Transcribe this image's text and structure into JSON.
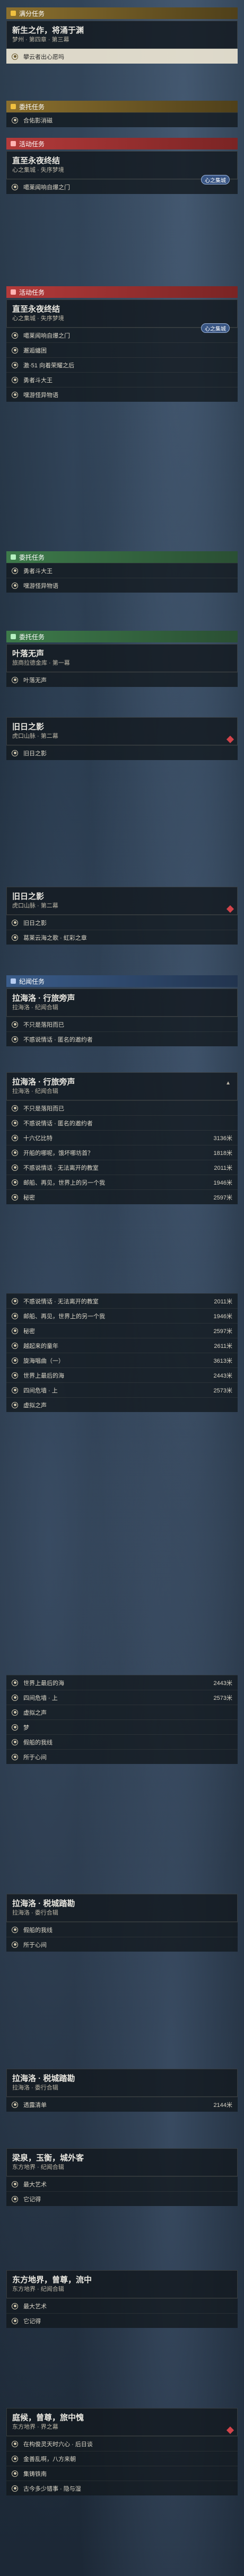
{
  "q1": {
    "tag": "满分任务",
    "title": "新生之作，将涌于渊",
    "sub": "梦州 · 第四章 · 第三幕",
    "items": [
      "攀云者出心愿吗"
    ]
  },
  "q2": {
    "tag": "委托任务",
    "items": [
      "合佑影消磁"
    ]
  },
  "q3": {
    "tag": "活动任务",
    "title": "直至永夜终结",
    "sub": "心之集城 · 失序梦境",
    "badge": "心之集城",
    "items": [
      "噶莱闻响自爆之门"
    ]
  },
  "q4": {
    "tag": "活动任务",
    "title": "直至永夜终结",
    "sub": "心之集城 · 失序梦境",
    "badge": "心之集城",
    "badge2": "嘿游怪异物语",
    "items": [
      "噶莱闻响自爆之门",
      "邂逅纏困",
      "激·51 向着荣耀之后",
      "勇者斗大王",
      "嘿游怪异物语"
    ]
  },
  "q5": {
    "tag": "委托任务",
    "badge": "嘿游怪异物语",
    "tag2": "叶落无声",
    "items": [
      "勇者斗大王",
      "嘿游怪异物语"
    ]
  },
  "q6": {
    "tag": "委托任务",
    "title": "叶落无声",
    "sub": "旅商拉德金库 · 第一幕",
    "items": [
      "叶落无声"
    ]
  },
  "q7": {
    "title": "旧日之影",
    "sub": "虎口山脉 · 第二幕",
    "items": [
      "旧日之影"
    ]
  },
  "q8": {
    "title": "旧日之影",
    "sub": "虎口山脉 · 第二幕",
    "items": [
      "旧日之影",
      "葛莱云海之歌 · 虹彩之章"
    ]
  },
  "q9": {
    "tag": "纪闻任务",
    "title": "拉海洛 · 行旅旁声",
    "sub": "拉海洛 · 纪闻合辑",
    "items": [
      "不只是落阳而已",
      "不惑说情话 · 匿名的邀约者"
    ]
  },
  "q10": {
    "title": "拉海洛 · 行旅旁声",
    "sub": "拉海洛 · 纪闻合辑",
    "items": [
      {
        "label": "不只是落阳而已",
        "val": ""
      },
      {
        "label": "不惑说情话 · 匿名的邀约者",
        "val": ""
      },
      {
        "label": "十六亿比特",
        "val": "3136米"
      },
      {
        "label": "开船的哪呢，饿坏哪坊首？",
        "val": "1818米"
      },
      {
        "label": "不惑说情话 · 无法离开的教室",
        "val": "2011米"
      },
      {
        "label": "邮船、再见，世界上的另一个我",
        "val": "1946米"
      },
      {
        "label": "秘密",
        "val": "2597米"
      }
    ]
  },
  "q11": {
    "items": [
      {
        "label": "不惑说情话 · 无法离开的教室",
        "val": "2011米"
      },
      {
        "label": "邮船、再见，世界上的另一个我",
        "val": "1946米"
      },
      {
        "label": "秘密",
        "val": "2597米"
      },
      {
        "label": "越起来的童年",
        "val": "2611米"
      },
      {
        "label": "旋海唱曲（一）",
        "val": "3613米"
      },
      {
        "label": "世界上最后的海",
        "val": "2443米"
      },
      {
        "label": "四间危墙 · 上",
        "val": "2573米"
      },
      {
        "label": "虚拟之声",
        "val": ""
      }
    ]
  },
  "q12": {
    "items": [
      {
        "label": "世界上最后的海",
        "val": "2443米"
      },
      {
        "label": "四间危墙 · 上",
        "val": "2573米"
      },
      {
        "label": "虚拟之声",
        "val": ""
      },
      {
        "label": "梦",
        "val": ""
      },
      {
        "label": "假船的我线",
        "val": ""
      },
      {
        "label": "所于心间",
        "val": ""
      }
    ]
  },
  "q13": {
    "title": "拉海洛 · 税城踏勘",
    "sub": "拉海洛 · 委行合辑",
    "items": [
      "假船的我线",
      "所于心间"
    ]
  },
  "q14": {
    "title": "拉海洛 · 税城踏勘",
    "sub": "拉海洛 · 委行合辑",
    "items": [
      {
        "label": "透露清单",
        "val": "2144米"
      }
    ]
  },
  "q15": {
    "title": "梁泉，玉衡，城外客",
    "sub": "东方地界 · 纪闻合辑",
    "items": [
      "最大艺术",
      "它记得"
    ]
  },
  "q16": {
    "title": "东方地界，曾尊，流中",
    "sub": "东方地界 · 纪闻合辑",
    "items": [
      "最大艺术",
      "它记得"
    ]
  },
  "q17": {
    "title": "庭候，曾尊，旅中愧",
    "sub": "东方地界 · 界之幕",
    "items": [
      "在构俊灵天时六心 · 后日谈",
      "金善乱啊，八方来朝",
      "集铸铁南",
      "古今多少错事 · 隐与湿"
    ]
  }
}
